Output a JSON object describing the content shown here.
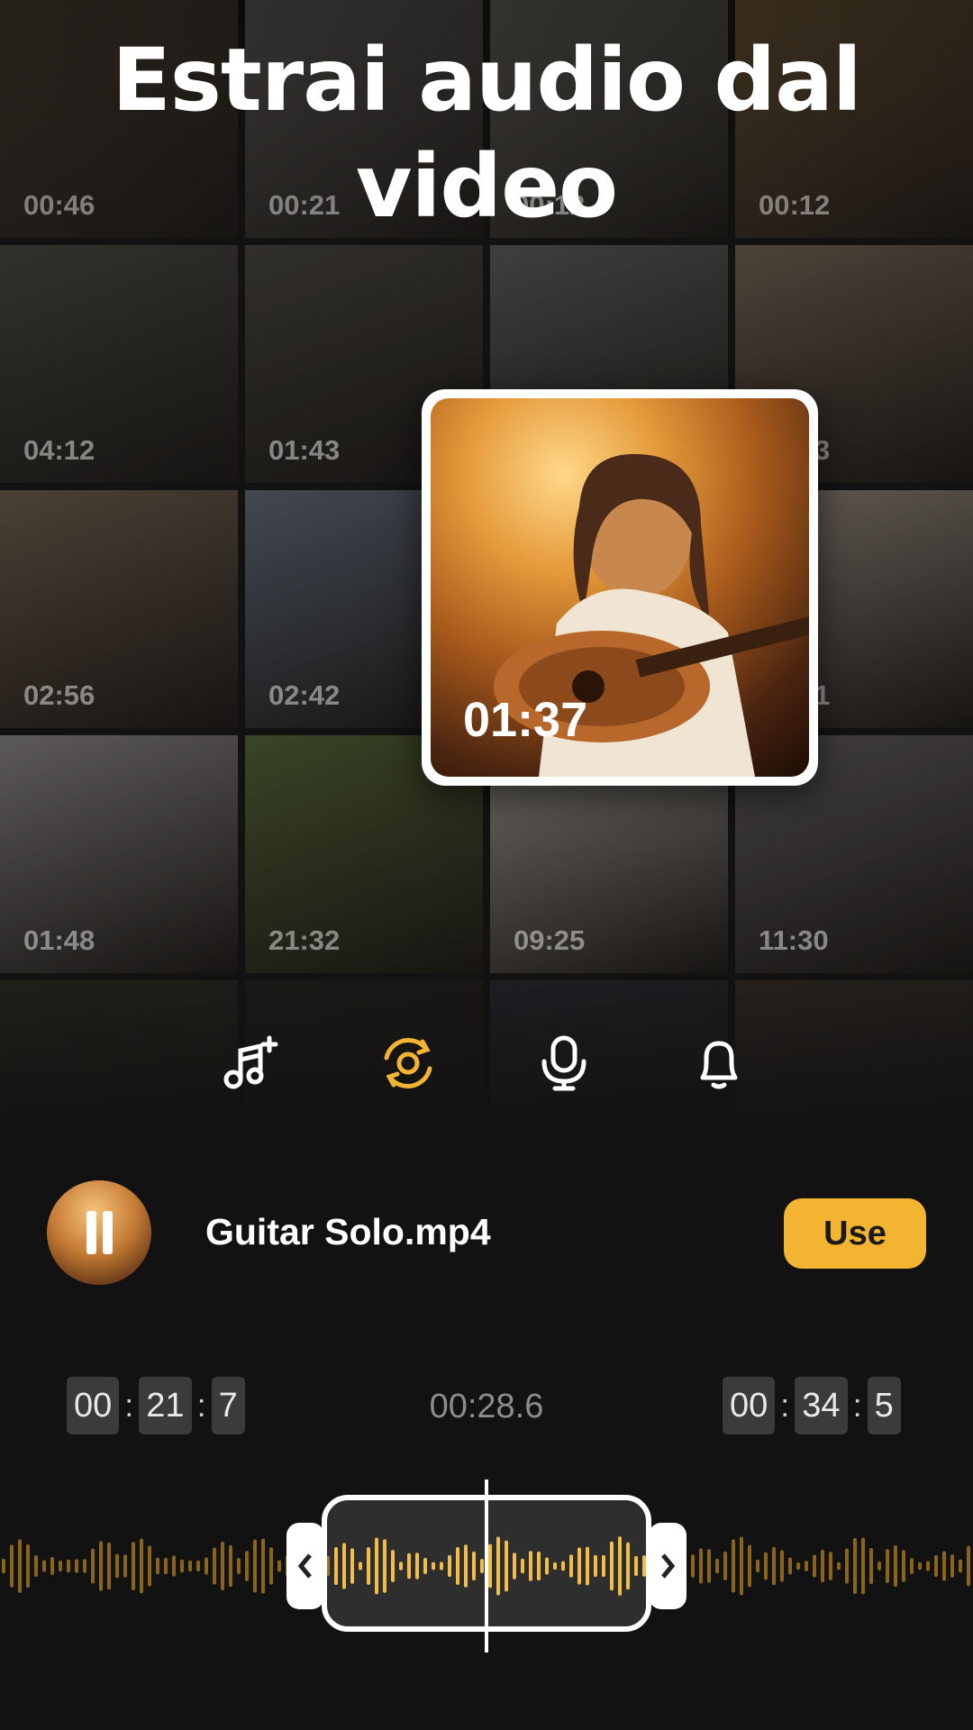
{
  "headline": "Estrai audio dal video",
  "grid_tiles": [
    {
      "duration": "00:46",
      "color": "#6b5c4a"
    },
    {
      "duration": "00:21",
      "color": "#8a8580"
    },
    {
      "duration": "00:12",
      "color": "#8f8a80"
    },
    {
      "duration": "00:12",
      "color": "#9a7a50"
    },
    {
      "duration": "04:12",
      "color": "#5b5a52"
    },
    {
      "duration": "01:43",
      "color": "#5a5650"
    },
    {
      "duration": "",
      "color": "#6f7570"
    },
    {
      "duration": "01:43",
      "color": "#8d7b66"
    },
    {
      "duration": "02:56",
      "color": "#8a7560"
    },
    {
      "duration": "02:42",
      "color": "#7a8595"
    },
    {
      "duration": "",
      "color": "#6b645c"
    },
    {
      "duration": "02:41",
      "color": "#b5a99a"
    },
    {
      "duration": "01:48",
      "color": "#a9a5a2"
    },
    {
      "duration": "21:32",
      "color": "#6b7d45"
    },
    {
      "duration": "09:25",
      "color": "#c9c3bb"
    },
    {
      "duration": "11:30",
      "color": "#7b7775"
    },
    {
      "duration": "",
      "color": "#4a4a3a"
    },
    {
      "duration": "",
      "color": "#3a3630"
    },
    {
      "duration": "",
      "color": "#3f4650"
    },
    {
      "duration": "",
      "color": "#5a4d42"
    }
  ],
  "featured": {
    "duration": "01:37"
  },
  "toolbar": {
    "icons": [
      "music-add-icon",
      "extract-audio-icon",
      "microphone-icon",
      "bell-icon"
    ],
    "active_color": "#f2b431",
    "inactive_color": "#ffffff"
  },
  "player": {
    "filename": "Guitar Solo.mp4",
    "use_label": "Use",
    "state": "playing"
  },
  "trim": {
    "start": {
      "mm": "00",
      "ss": "21",
      "f": "7"
    },
    "current": "00:28.6",
    "end": {
      "mm": "00",
      "ss": "34",
      "f": "5"
    }
  },
  "colors": {
    "accent": "#f2b431",
    "background": "#121212"
  }
}
